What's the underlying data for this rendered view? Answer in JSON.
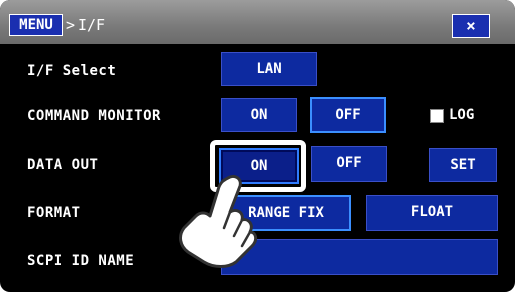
{
  "header": {
    "menu_label": "MENU",
    "separator": ">",
    "crumb": "I/F",
    "close_label": "×"
  },
  "rows": {
    "if_select": {
      "label": "I/F Select",
      "value": "LAN"
    },
    "command_monitor": {
      "label": "COMMAND MONITOR",
      "on": "ON",
      "off": "OFF",
      "log_label": "LOG"
    },
    "data_out": {
      "label": "DATA OUT",
      "on": "ON",
      "off": "OFF",
      "set": "SET"
    },
    "format": {
      "label": "FORMAT",
      "range_fix": "RANGE FIX",
      "float": "FLOAT"
    },
    "scpi_id": {
      "label": "SCPI ID NAME",
      "value": ""
    }
  },
  "colors": {
    "button_blue": "#0d2aa0",
    "active_border": "#3b8fff",
    "background": "#000000"
  },
  "icons": {
    "pointer": "hand-pointer-icon",
    "close": "close-icon"
  }
}
